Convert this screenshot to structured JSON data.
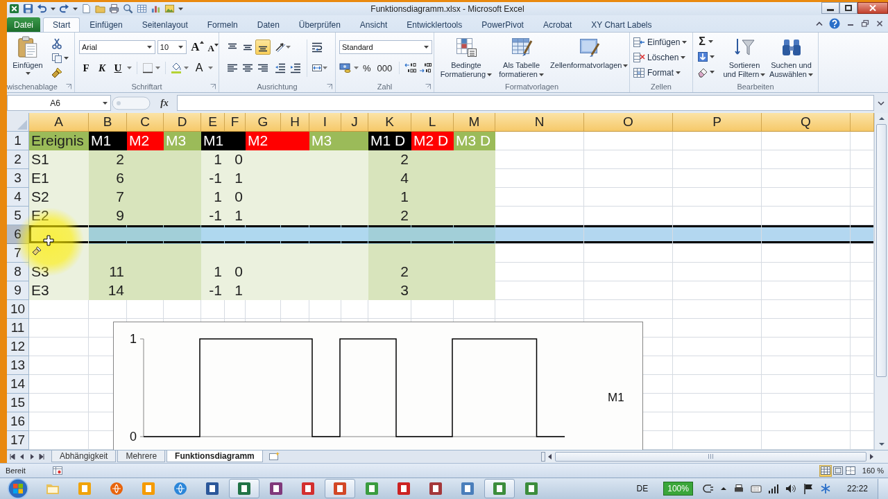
{
  "window": {
    "title": "Funktionsdiagramm.xlsx - Microsoft Excel"
  },
  "ribbon_tabs": {
    "file_button": "Datei",
    "tabs": [
      {
        "label": "Start",
        "selected": true
      },
      {
        "label": "Einfügen",
        "selected": false
      },
      {
        "label": "Seitenlayout",
        "selected": false
      },
      {
        "label": "Formeln",
        "selected": false
      },
      {
        "label": "Daten",
        "selected": false
      },
      {
        "label": "Überprüfen",
        "selected": false
      },
      {
        "label": "Ansicht",
        "selected": false
      },
      {
        "label": "Entwicklertools",
        "selected": false
      },
      {
        "label": "PowerPivot",
        "selected": false
      },
      {
        "label": "Acrobat",
        "selected": false
      },
      {
        "label": "XY Chart Labels",
        "selected": false
      }
    ]
  },
  "ribbon": {
    "clipboard": {
      "label": "wischenablage",
      "paste_button": "Einfügen"
    },
    "font": {
      "label": "Schriftart",
      "font_name": "Arial",
      "font_size": "10",
      "size_buttons": [
        {
          "label": "A",
          "kind": "grow"
        },
        {
          "label": "A",
          "kind": "shrink"
        }
      ],
      "style_buttons": [
        {
          "label": "F",
          "kind": "bold"
        },
        {
          "label": "K",
          "kind": "italic"
        },
        {
          "label": "U",
          "kind": "underline"
        }
      ],
      "font_color_button": "A"
    },
    "alignment": {
      "label": "Ausrichtung",
      "vertical_buttons": [
        {
          "kind": "top",
          "selected": false
        },
        {
          "kind": "middle",
          "selected": false
        },
        {
          "kind": "bottom",
          "selected": true
        }
      ],
      "horizontal_buttons": [
        {
          "kind": "left",
          "selected": false
        },
        {
          "kind": "center",
          "selected": false
        },
        {
          "kind": "right",
          "selected": false
        }
      ]
    },
    "number": {
      "label": "Zahl",
      "format": "Standard",
      "buttons": [
        "%",
        "000"
      ]
    },
    "styles": {
      "label": "Formatvorlagen",
      "buttons": [
        {
          "label": "Bedingte Formatierung",
          "kind": "conditional"
        },
        {
          "label": "Als Tabelle formatieren",
          "kind": "table"
        },
        {
          "label": "Zellenformatvorlagen",
          "kind": "cellstyles"
        }
      ]
    },
    "cells": {
      "label": "Zellen",
      "buttons": [
        {
          "label": "Einfügen",
          "kind": "insert"
        },
        {
          "label": "Löschen",
          "kind": "delete"
        },
        {
          "label": "Format",
          "kind": "format"
        }
      ]
    },
    "editing": {
      "label": "Bearbeiten",
      "sum_button": "Σ",
      "buttons": [
        {
          "label": "Sortieren und Filtern",
          "kind": "sort"
        },
        {
          "label": "Suchen und Auswählen",
          "kind": "find"
        }
      ]
    }
  },
  "formula_bar": {
    "name_box": "A6",
    "function_button": "fx"
  },
  "sheet": {
    "columns": [
      "A",
      "B",
      "C",
      "D",
      "E",
      "F",
      "G",
      "H",
      "I",
      "J",
      "K",
      "L",
      "M",
      "N",
      "O",
      "P",
      "Q"
    ],
    "rows": [
      {
        "number": "1",
        "selected": false,
        "cells": [
          {
            "text": "Ereignis",
            "kind": "text",
            "color": "#9bbb59"
          },
          {
            "text": "M1",
            "kind": "header",
            "color": "#000000"
          },
          {
            "text": "M2",
            "kind": "header",
            "color": "#ff0000"
          },
          {
            "text": "M3",
            "kind": "header",
            "color": "#9bbb59"
          },
          {
            "text": "M1",
            "kind": "header",
            "color": "#000000"
          },
          {
            "color": "#000000"
          },
          {
            "text": "M2",
            "kind": "header",
            "color": "#ff0000"
          },
          {
            "color": "#ff0000"
          },
          {
            "text": "M3",
            "kind": "header",
            "color": "#9bbb59"
          },
          {
            "color": "#9bbb59"
          },
          {
            "text": "M1 D",
            "kind": "header",
            "color": "#000000"
          },
          {
            "text": "M2 D",
            "kind": "header",
            "color": "#ff0000"
          },
          {
            "text": "M3 D",
            "kind": "header",
            "color": "#9bbb59"
          }
        ]
      },
      {
        "number": "2",
        "selected": false,
        "cells": [
          {
            "text": "S1",
            "kind": "text",
            "color": "#ebf1de"
          },
          {
            "text": "2",
            "kind": "number",
            "color": "#d8e4bc"
          },
          {
            "color": "#d8e4bc"
          },
          {
            "color": "#d8e4bc"
          },
          {
            "text": "1",
            "kind": "number",
            "color": "#ebf1de"
          },
          {
            "text": "0",
            "kind": "number",
            "color": "#ebf1de"
          },
          {
            "color": "#ebf1de"
          },
          {
            "color": "#ebf1de"
          },
          {
            "color": "#ebf1de"
          },
          {
            "color": "#ebf1de"
          },
          {
            "text": "2",
            "kind": "number",
            "color": "#d8e4bc"
          },
          {
            "color": "#d8e4bc"
          },
          {
            "color": "#d8e4bc"
          }
        ]
      },
      {
        "number": "3",
        "selected": false,
        "cells": [
          {
            "text": "E1",
            "kind": "text",
            "color": "#ebf1de"
          },
          {
            "text": "6",
            "kind": "number",
            "color": "#d8e4bc"
          },
          {
            "color": "#d8e4bc"
          },
          {
            "color": "#d8e4bc"
          },
          {
            "text": "-1",
            "kind": "number",
            "color": "#ebf1de"
          },
          {
            "text": "1",
            "kind": "number",
            "color": "#ebf1de"
          },
          {
            "color": "#ebf1de"
          },
          {
            "color": "#ebf1de"
          },
          {
            "color": "#ebf1de"
          },
          {
            "color": "#ebf1de"
          },
          {
            "text": "4",
            "kind": "number",
            "color": "#d8e4bc"
          },
          {
            "color": "#d8e4bc"
          },
          {
            "color": "#d8e4bc"
          }
        ]
      },
      {
        "number": "4",
        "selected": false,
        "cells": [
          {
            "text": "S2",
            "kind": "text",
            "color": "#ebf1de"
          },
          {
            "text": "7",
            "kind": "number",
            "color": "#d8e4bc"
          },
          {
            "color": "#d8e4bc"
          },
          {
            "color": "#d8e4bc"
          },
          {
            "text": "1",
            "kind": "number",
            "color": "#ebf1de"
          },
          {
            "text": "0",
            "kind": "number",
            "color": "#ebf1de"
          },
          {
            "color": "#ebf1de"
          },
          {
            "color": "#ebf1de"
          },
          {
            "color": "#ebf1de"
          },
          {
            "color": "#ebf1de"
          },
          {
            "text": "1",
            "kind": "number",
            "color": "#d8e4bc"
          },
          {
            "color": "#d8e4bc"
          },
          {
            "color": "#d8e4bc"
          }
        ]
      },
      {
        "number": "5",
        "selected": false,
        "cells": [
          {
            "text": "E2",
            "kind": "text",
            "color": "#ebf1de"
          },
          {
            "text": "9",
            "kind": "number",
            "color": "#d8e4bc"
          },
          {
            "color": "#d8e4bc"
          },
          {
            "color": "#d8e4bc"
          },
          {
            "text": "-1",
            "kind": "number",
            "color": "#ebf1de"
          },
          {
            "text": "1",
            "kind": "number",
            "color": "#ebf1de"
          },
          {
            "color": "#ebf1de"
          },
          {
            "color": "#ebf1de"
          },
          {
            "color": "#ebf1de"
          },
          {
            "color": "#ebf1de"
          },
          {
            "text": "2",
            "kind": "number",
            "color": "#d8e4bc"
          },
          {
            "color": "#d8e4bc"
          },
          {
            "color": "#d8e4bc"
          }
        ]
      },
      {
        "number": "6",
        "selected": true,
        "cells": [
          {
            "color": "#ebf1de"
          },
          {
            "color": "#a2cfd8"
          },
          {
            "color": "#a2cfd8"
          },
          {
            "color": "#a2cfd8"
          },
          {
            "color": "#afd8ef"
          },
          {
            "color": "#afd8ef"
          },
          {
            "color": "#afd8ef"
          },
          {
            "color": "#afd8ef"
          },
          {
            "color": "#afd8ef"
          },
          {
            "color": "#afd8ef"
          },
          {
            "color": "#a2cfd8"
          },
          {
            "color": "#a2cfd8"
          },
          {
            "color": "#a2cfd8"
          }
        ]
      },
      {
        "number": "7",
        "selected": false,
        "cells": [
          {
            "color": "#ebf1de"
          },
          {
            "color": "#d8e4bc"
          },
          {
            "color": "#d8e4bc"
          },
          {
            "color": "#d8e4bc"
          },
          {
            "color": "#ebf1de"
          },
          {
            "color": "#ebf1de"
          },
          {
            "color": "#ebf1de"
          },
          {
            "color": "#ebf1de"
          },
          {
            "color": "#ebf1de"
          },
          {
            "color": "#ebf1de"
          },
          {
            "color": "#d8e4bc"
          },
          {
            "color": "#d8e4bc"
          },
          {
            "color": "#d8e4bc"
          }
        ]
      },
      {
        "number": "8",
        "selected": false,
        "cells": [
          {
            "text": "S3",
            "kind": "text",
            "color": "#ebf1de"
          },
          {
            "text": "11",
            "kind": "number",
            "color": "#d8e4bc"
          },
          {
            "color": "#d8e4bc"
          },
          {
            "color": "#d8e4bc"
          },
          {
            "text": "1",
            "kind": "number",
            "color": "#ebf1de"
          },
          {
            "text": "0",
            "kind": "number",
            "color": "#ebf1de"
          },
          {
            "color": "#ebf1de"
          },
          {
            "color": "#ebf1de"
          },
          {
            "color": "#ebf1de"
          },
          {
            "color": "#ebf1de"
          },
          {
            "text": "2",
            "kind": "number",
            "color": "#d8e4bc"
          },
          {
            "color": "#d8e4bc"
          },
          {
            "color": "#d8e4bc"
          }
        ]
      },
      {
        "number": "9",
        "selected": false,
        "cells": [
          {
            "text": "E3",
            "kind": "text",
            "color": "#ebf1de"
          },
          {
            "text": "14",
            "kind": "number",
            "color": "#d8e4bc"
          },
          {
            "color": "#d8e4bc"
          },
          {
            "color": "#d8e4bc"
          },
          {
            "text": "-1",
            "kind": "number",
            "color": "#ebf1de"
          },
          {
            "text": "1",
            "kind": "number",
            "color": "#ebf1de"
          },
          {
            "color": "#ebf1de"
          },
          {
            "color": "#ebf1de"
          },
          {
            "color": "#ebf1de"
          },
          {
            "color": "#ebf1de"
          },
          {
            "text": "3",
            "kind": "number",
            "color": "#d8e4bc"
          },
          {
            "color": "#d8e4bc"
          },
          {
            "color": "#d8e4bc"
          }
        ]
      },
      {
        "number": "10",
        "selected": false
      },
      {
        "number": "11",
        "selected": false
      },
      {
        "number": "12",
        "selected": false
      },
      {
        "number": "13",
        "selected": false
      },
      {
        "number": "14",
        "selected": false
      },
      {
        "number": "15",
        "selected": false
      },
      {
        "number": "16",
        "selected": false
      },
      {
        "number": "17",
        "selected": false
      }
    ],
    "chart": {
      "axis_labels": [
        "1",
        "0"
      ],
      "legend": "M1"
    }
  },
  "sheet_tabs": [
    {
      "label": "Abhängigkeit",
      "selected": false
    },
    {
      "label": "Mehrere",
      "selected": false
    },
    {
      "label": "Funktionsdiagramm",
      "selected": true
    }
  ],
  "status_bar": {
    "status": "Bereit",
    "views": [
      {
        "kind": "normal",
        "selected": true
      },
      {
        "kind": "page_layout",
        "selected": false
      },
      {
        "kind": "page_break",
        "selected": false
      }
    ],
    "zoom": "160 %"
  },
  "taskbar": {
    "apps": [
      {
        "kind": "folder",
        "color": "#e8c15a",
        "active": false
      },
      {
        "kind": "tile",
        "color": "#f0a30a",
        "active": false
      },
      {
        "kind": "globe",
        "color": "#e8640c",
        "active": false
      },
      {
        "kind": "tile",
        "color": "#f59b00",
        "active": false
      },
      {
        "kind": "globe",
        "color": "#2b86d9",
        "active": false
      },
      {
        "kind": "tile",
        "color": "#2b579a",
        "active": false
      },
      {
        "kind": "tile",
        "color": "#217346",
        "active": true
      },
      {
        "kind": "tile",
        "color": "#80397b",
        "active": false
      },
      {
        "kind": "tile",
        "color": "#d32f2f",
        "active": false
      },
      {
        "kind": "tile",
        "color": "#d24726",
        "active": true
      },
      {
        "kind": "tile",
        "color": "#3a9c3f",
        "active": false
      },
      {
        "kind": "tile",
        "color": "#cc2222",
        "active": false
      },
      {
        "kind": "tile",
        "color": "#a4373a",
        "active": false
      },
      {
        "kind": "tile",
        "color": "#4a7ebb",
        "active": false
      },
      {
        "kind": "tile",
        "color": "#3c8d3c",
        "active": true
      },
      {
        "kind": "tile",
        "color": "#3c8d3c",
        "active": false
      }
    ],
    "language": "DE",
    "indicator": "100%",
    "time": "22:22"
  }
}
